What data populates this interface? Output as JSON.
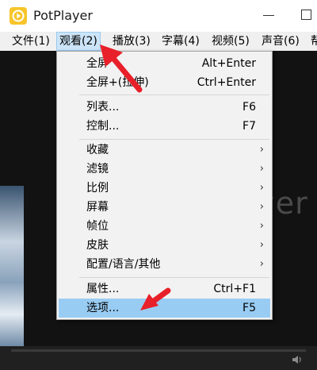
{
  "window": {
    "title": "PotPlayer",
    "logo_icon": "potplayer-logo-icon",
    "accent_color": "#f7c52b"
  },
  "menubar": {
    "items": [
      {
        "label": "文件(1)"
      },
      {
        "label": "观看(2)",
        "active": true
      },
      {
        "label": "播放(3)"
      },
      {
        "label": "字幕(4)"
      },
      {
        "label": "视频(5)"
      },
      {
        "label": "声音(6)"
      },
      {
        "label": "帮"
      }
    ]
  },
  "dropdown": {
    "items": [
      {
        "label": "全屏",
        "shortcut": "Alt+Enter"
      },
      {
        "label": "全屏+(拉伸)",
        "shortcut": "Ctrl+Enter"
      },
      {
        "label": "列表...",
        "shortcut": "F6"
      },
      {
        "label": "控制...",
        "shortcut": "F7"
      },
      {
        "label": "收藏",
        "submenu": true
      },
      {
        "label": "滤镜",
        "submenu": true
      },
      {
        "label": "比例",
        "submenu": true
      },
      {
        "label": "屏幕",
        "submenu": true
      },
      {
        "label": "帧位",
        "submenu": true
      },
      {
        "label": "皮肤",
        "submenu": true
      },
      {
        "label": "配置/语言/其他",
        "submenu": true
      },
      {
        "label": "属性...",
        "shortcut": "Ctrl+F1"
      },
      {
        "label": "选项...",
        "shortcut": "F5",
        "highlighted": true
      }
    ],
    "submenu_glyph": "›",
    "highlight_color": "#99ccf3"
  },
  "video": {
    "watermark": "ayer"
  },
  "annotation": {
    "arrow_color": "#e8202a"
  }
}
